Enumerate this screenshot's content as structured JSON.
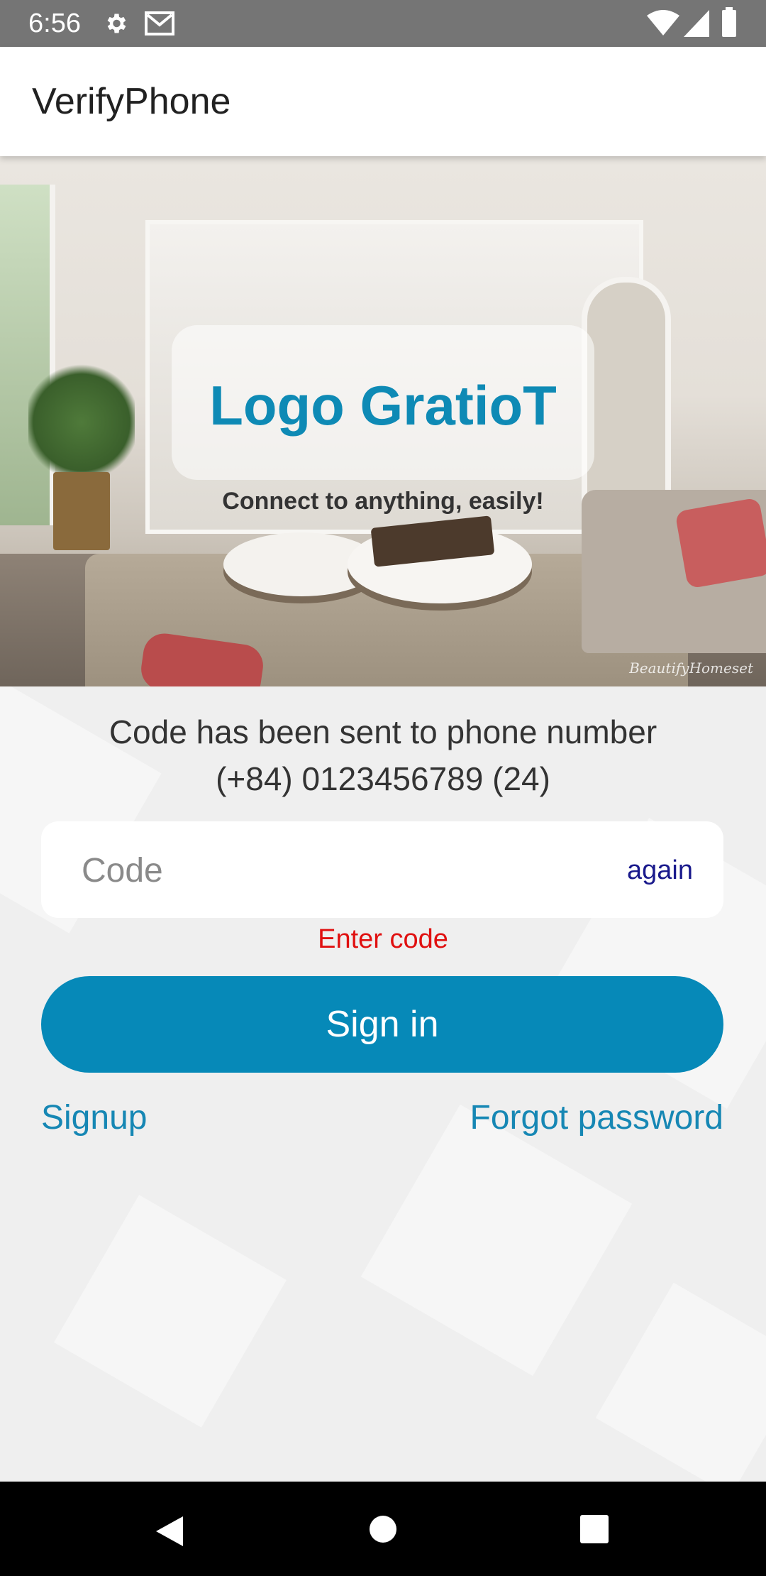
{
  "status_bar": {
    "time": "6:56",
    "icons": [
      "settings-icon",
      "gmail-icon",
      "wifi-icon",
      "signal-icon",
      "battery-icon"
    ]
  },
  "app_bar": {
    "title": "VerifyPhone"
  },
  "hero": {
    "logo_text": "Logo GratioT",
    "tagline": "Connect to anything, easily!",
    "watermark": "BeautifyHomeset"
  },
  "verify": {
    "message_line1": "Code has been sent to phone number",
    "message_line2": "(+84) 0123456789  (24)",
    "code_placeholder": "Code",
    "code_value": "",
    "again_label": "again",
    "error_text": "Enter code",
    "signin_label": "Sign in",
    "signup_label": "Signup",
    "forgot_label": "Forgot password"
  },
  "nav_bar": {
    "icons": [
      "back-icon",
      "home-icon",
      "recents-icon"
    ]
  },
  "colors": {
    "accent": "#0689b8",
    "logo": "#0e8ab5",
    "error": "#e01010",
    "again": "#1a1a8c",
    "link": "#1687b4"
  }
}
